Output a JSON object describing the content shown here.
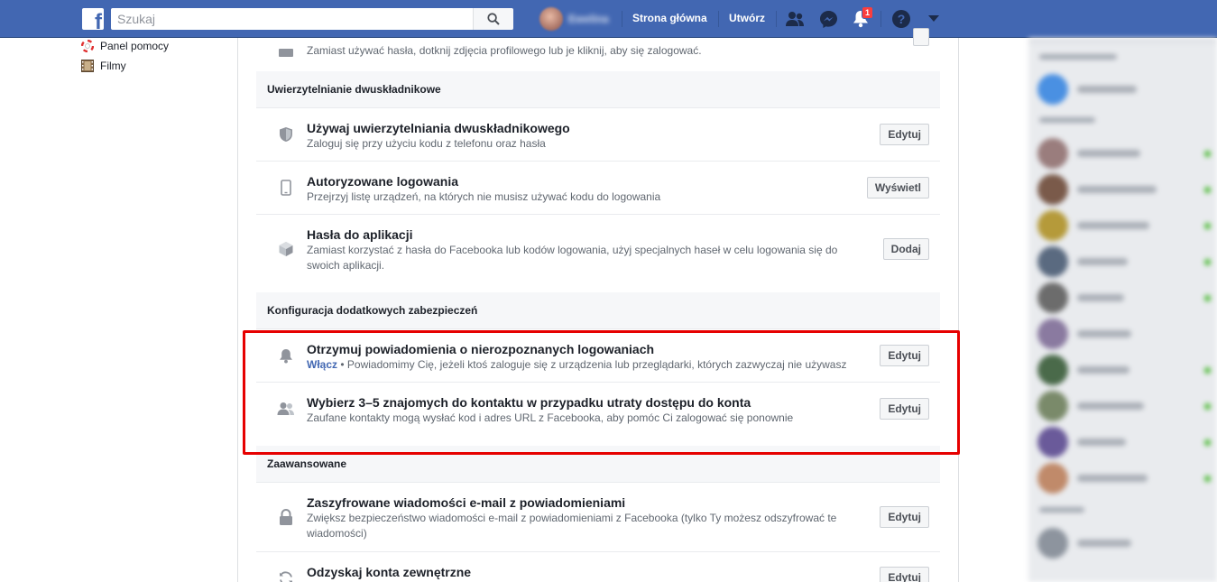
{
  "topbar": {
    "search_placeholder": "Szukaj",
    "profile_name": "Ewelina",
    "home": "Strona główna",
    "create": "Utwórz",
    "notification_count": "1",
    "colors": {
      "bar": "#4267b2",
      "badge": "#fa3e3e"
    }
  },
  "left_nav": [
    {
      "label": "Panel pomocy",
      "icon": "lifebuoy-icon"
    },
    {
      "label": "Filmy",
      "icon": "film-icon"
    }
  ],
  "sections": {
    "top_partial_row": {
      "desc": "Zamiast używać hasła, dotknij zdjęcia profilowego lub je kliknij, aby się zalogować."
    },
    "two_factor": {
      "heading": "Uwierzytelnianie dwuskładnikowe",
      "rows": [
        {
          "title": "Używaj uwierzytelniania dwuskładnikowego",
          "desc": "Zaloguj się przy użyciu kodu z telefonu oraz hasła",
          "button": "Edytuj",
          "icon": "shield-icon"
        },
        {
          "title": "Autoryzowane logowania",
          "desc": "Przejrzyj listę urządzeń, na których nie musisz używać kodu do logowania",
          "button": "Wyświetl",
          "icon": "phone-icon"
        },
        {
          "title": "Hasła do aplikacji",
          "desc": "Zamiast korzystać z hasła do Facebooka lub kodów logowania, użyj specjalnych haseł w celu logowania się do swoich aplikacji.",
          "button": "Dodaj",
          "icon": "cube-icon"
        }
      ]
    },
    "extra": {
      "heading": "Konfiguracja dodatkowych zabezpieczeń",
      "rows": [
        {
          "title": "Otrzymuj powiadomienia o nierozpoznanych logowaniach",
          "status": "Włącz",
          "desc": " • Powiadomimy Cię, jeżeli ktoś zaloguje się z urządzenia lub przeglądarki, których zazwyczaj nie używasz",
          "button": "Edytuj",
          "icon": "bell-icon"
        },
        {
          "title": "Wybierz 3–5 znajomych do kontaktu w przypadku utraty dostępu do konta",
          "desc": "Zaufane kontakty mogą wysłać kod i adres URL z Facebooka, aby pomóc Ci zalogować się ponownie",
          "button": "Edytuj",
          "icon": "friends-icon"
        }
      ]
    },
    "advanced": {
      "heading": "Zaawansowane",
      "rows": [
        {
          "title": "Zaszyfrowane wiadomości e-mail z powiadomieniami",
          "desc": "Zwiększ bezpieczeństwo wiadomości e-mail z powiadomieniami z Facebooka (tylko Ty możesz odszyfrować te wiadomości)",
          "button": "Edytuj",
          "icon": "lock-icon"
        },
        {
          "title": "Odzyskaj konta zewnętrzne",
          "button": "Edytuj",
          "icon": "refresh-icon"
        }
      ]
    }
  },
  "highlight_color": "#e60000"
}
